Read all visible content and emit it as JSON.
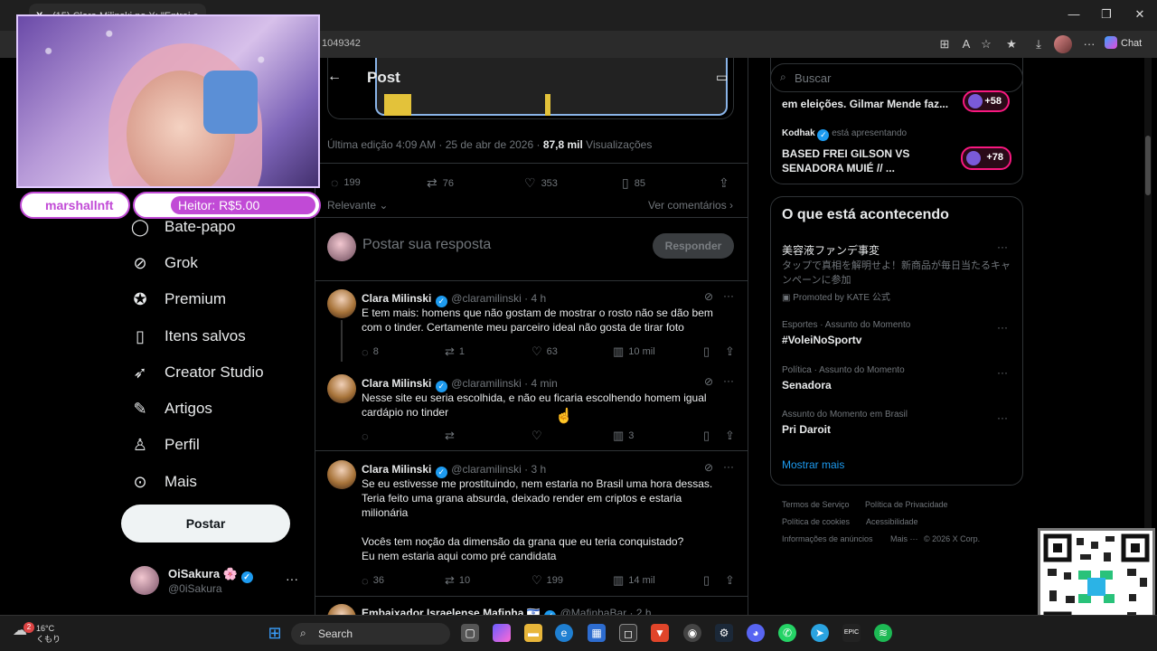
{
  "browser": {
    "tab_title": "(15) Clara Milinski no X: \"Entrei e",
    "url_fragment": "1049342",
    "chat_label": "Chat"
  },
  "stream": {
    "badge_left": "marshallnft",
    "badge_right": "Heitor: R$5.00"
  },
  "nav": {
    "items": [
      {
        "label": "Bate-papo",
        "icon": "chat-icon"
      },
      {
        "label": "Grok",
        "icon": "grok-icon"
      },
      {
        "label": "Premium",
        "icon": "premium-icon"
      },
      {
        "label": "Itens salvos",
        "icon": "bookmark-icon"
      },
      {
        "label": "Creator Studio",
        "icon": "rocket-icon"
      },
      {
        "label": "Artigos",
        "icon": "article-icon"
      },
      {
        "label": "Perfil",
        "icon": "person-icon"
      },
      {
        "label": "Mais",
        "icon": "more-circle-icon"
      }
    ],
    "post_button": "Postar",
    "profile": {
      "name": "OiSakura 🌸",
      "handle": "@0iSakura",
      "more": "···"
    }
  },
  "post": {
    "header_title": "Post",
    "meta_prefix": "Última edição 4:09 AM · 25 de abr de 2026 · ",
    "views_count": "87,8 mil",
    "views_label": " Visualizações",
    "stats": {
      "replies": "199",
      "reposts": "76",
      "likes": "353",
      "bookmarks": "85"
    },
    "sort_label": "Relevante",
    "see_comments": "Ver comentários",
    "reply_placeholder": "Postar sua resposta",
    "reply_button": "Responder"
  },
  "tweets": [
    {
      "name": "Clara Milinski",
      "handle": "@claramilinski · 4 h",
      "text": "E tem mais: homens que não gostam de mostrar o rosto não se dão bem com o tinder. Certamente meu parceiro ideal não gosta de tirar foto",
      "replies": "8",
      "reposts": "1",
      "likes": "63",
      "views": "10 mil"
    },
    {
      "name": "Clara Milinski",
      "handle": "@claramilinski · 4 min",
      "text": "Nesse site eu seria escolhida, e não eu ficaria escolhendo homem igual cardápio no tinder",
      "replies": "",
      "reposts": "",
      "likes": "",
      "views": "3"
    },
    {
      "name": "Clara Milinski",
      "handle": "@claramilinski · 3 h",
      "text": "Se eu estivesse me prostituindo, nem estaria no Brasil uma hora dessas. Teria feito uma grana absurda, deixado render em criptos e estaria milionária",
      "text2": "Vocês tem noção da dimensão da grana que eu teria conquistado?\nEu nem estaria aqui como pré candidata",
      "replies": "36",
      "reposts": "10",
      "likes": "199",
      "views": "14 mil"
    },
    {
      "name": "Embaixador Israelense Mafinha 🇮🇱",
      "handle": "@MafinhaBar · 2 h"
    }
  ],
  "right": {
    "search_placeholder": "Buscar",
    "live": [
      {
        "title": "em eleições. Gilmar Mende faz...",
        "pill": "+58"
      },
      {
        "user": "Kodhak",
        "status": "está apresentando",
        "title": "BASED FREI GILSON VS\nSENADORA MUIÉ // ...",
        "pill": "+78"
      }
    ],
    "trends_title": "O que está acontecendo",
    "promo": {
      "name": "美容液ファンデ事変",
      "desc": "タップで真相を解明せよ！新商品が毎日当たるキャンペーンに参加",
      "promoted": "Promoted by KATE 公式"
    },
    "trends": [
      {
        "category": "Esportes · Assunto do Momento",
        "name": "#VoleiNoSportv"
      },
      {
        "category": "Política · Assunto do Momento",
        "name": "Senadora"
      },
      {
        "category": "Assunto do Momento em Brasil",
        "name": "Pri Daroit"
      }
    ],
    "show_more": "Mostrar mais",
    "footer": [
      "Termos de Serviço",
      "Política de Privacidade",
      "Política de cookies",
      "Acessibilidade",
      "Informações de anúncios",
      "Mais ···",
      "© 2026 X Corp."
    ]
  },
  "taskbar": {
    "temp": "16°C",
    "weather": "くもり",
    "weather_badge": "2",
    "search": "Search"
  },
  "colors": {
    "accent": "#1d9bf0",
    "live_pill": "#f91880",
    "stream_badge": "#c14ad6"
  }
}
